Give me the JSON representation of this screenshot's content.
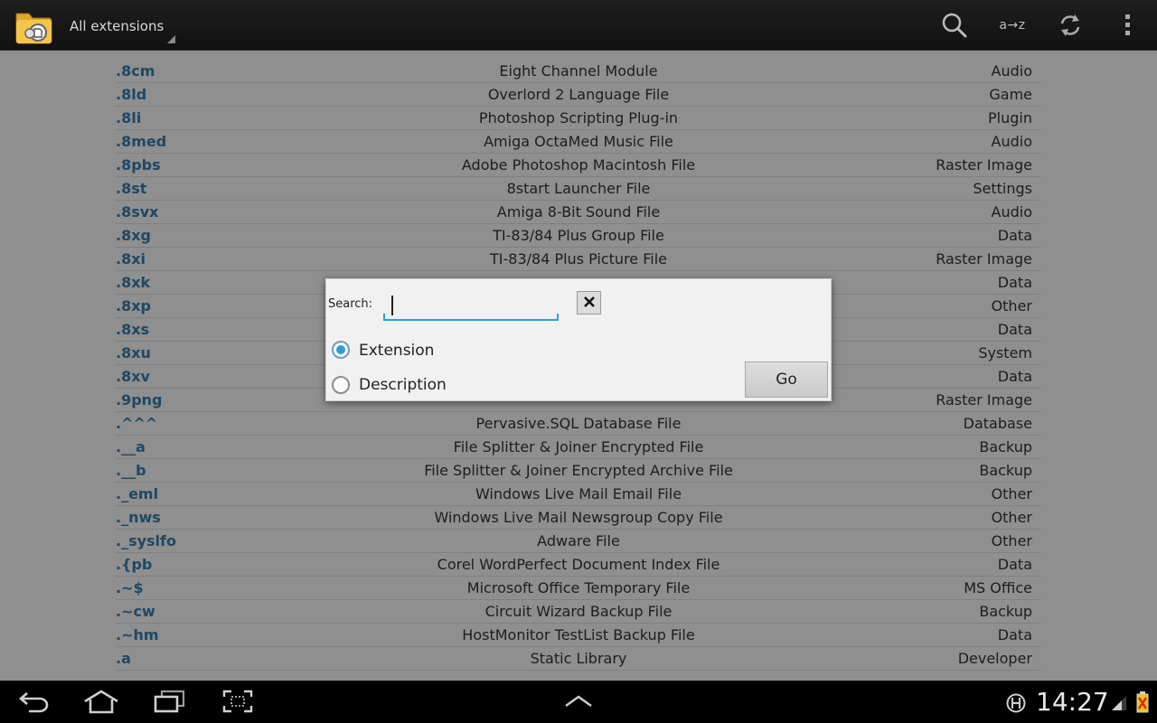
{
  "action_bar": {
    "title": "All extensions",
    "icons": [
      "app-folder-icon",
      "search-icon",
      "sort-az-icon",
      "refresh-icon",
      "overflow-menu-icon"
    ],
    "sort_label": "a→z"
  },
  "extensions": [
    {
      "ext": ".8cm",
      "description": "Eight Channel Module",
      "category": "Audio"
    },
    {
      "ext": ".8ld",
      "description": "Overlord 2 Language File",
      "category": "Game"
    },
    {
      "ext": ".8li",
      "description": "Photoshop Scripting Plug-in",
      "category": "Plugin"
    },
    {
      "ext": ".8med",
      "description": "Amiga OctaMed Music File",
      "category": "Audio"
    },
    {
      "ext": ".8pbs",
      "description": "Adobe Photoshop Macintosh File",
      "category": "Raster Image"
    },
    {
      "ext": ".8st",
      "description": "8start Launcher File",
      "category": "Settings"
    },
    {
      "ext": ".8svx",
      "description": "Amiga 8-Bit Sound File",
      "category": "Audio"
    },
    {
      "ext": ".8xg",
      "description": "TI-83/84 Plus Group File",
      "category": "Data"
    },
    {
      "ext": ".8xi",
      "description": "TI-83/84 Plus Picture File",
      "category": "Raster Image"
    },
    {
      "ext": ".8xk",
      "description": "",
      "category": "Data"
    },
    {
      "ext": ".8xp",
      "description": "",
      "category": "Other"
    },
    {
      "ext": ".8xs",
      "description": "",
      "category": "Data"
    },
    {
      "ext": ".8xu",
      "description": "",
      "category": "System"
    },
    {
      "ext": ".8xv",
      "description": "",
      "category": "Data"
    },
    {
      "ext": ".9png",
      "description": "",
      "category": "Raster Image"
    },
    {
      "ext": ".^^^",
      "description": "Pervasive.SQL Database File",
      "category": "Database"
    },
    {
      "ext": ".__a",
      "description": "File Splitter & Joiner Encrypted File",
      "category": "Backup"
    },
    {
      "ext": ".__b",
      "description": "File Splitter & Joiner Encrypted Archive File",
      "category": "Backup"
    },
    {
      "ext": "._eml",
      "description": "Windows Live Mail Email File",
      "category": "Other"
    },
    {
      "ext": "._nws",
      "description": "Windows Live Mail Newsgroup Copy File",
      "category": "Other"
    },
    {
      "ext": "._syslfo",
      "description": "Adware File",
      "category": "Other"
    },
    {
      "ext": ".{pb",
      "description": "Corel WordPerfect Document Index File",
      "category": "Data"
    },
    {
      "ext": ".~$",
      "description": "Microsoft Office Temporary File",
      "category": "MS Office"
    },
    {
      "ext": ".~cw",
      "description": "Circuit Wizard Backup File",
      "category": "Backup"
    },
    {
      "ext": ".~hm",
      "description": "HostMonitor TestList Backup File",
      "category": "Data"
    },
    {
      "ext": ".a",
      "description": "Static Library",
      "category": "Developer"
    }
  ],
  "dialog": {
    "search_label": "Search:",
    "search_value": "",
    "clear_icon": "close-icon",
    "options": [
      {
        "label": "Extension",
        "checked": true
      },
      {
        "label": "Description",
        "checked": false
      }
    ],
    "go_label": "Go"
  },
  "system_bar": {
    "icons": [
      "back-icon",
      "home-icon",
      "recent-apps-icon",
      "screenshot-icon",
      "expand-up-icon",
      "data-saver-icon",
      "signal-icon",
      "battery-icon"
    ],
    "time": "14:27"
  },
  "colors": {
    "accent": "#2f9ed8",
    "extension_text": "#3478a8",
    "action_bar": "#161616",
    "list_background": "#eeeeee"
  }
}
